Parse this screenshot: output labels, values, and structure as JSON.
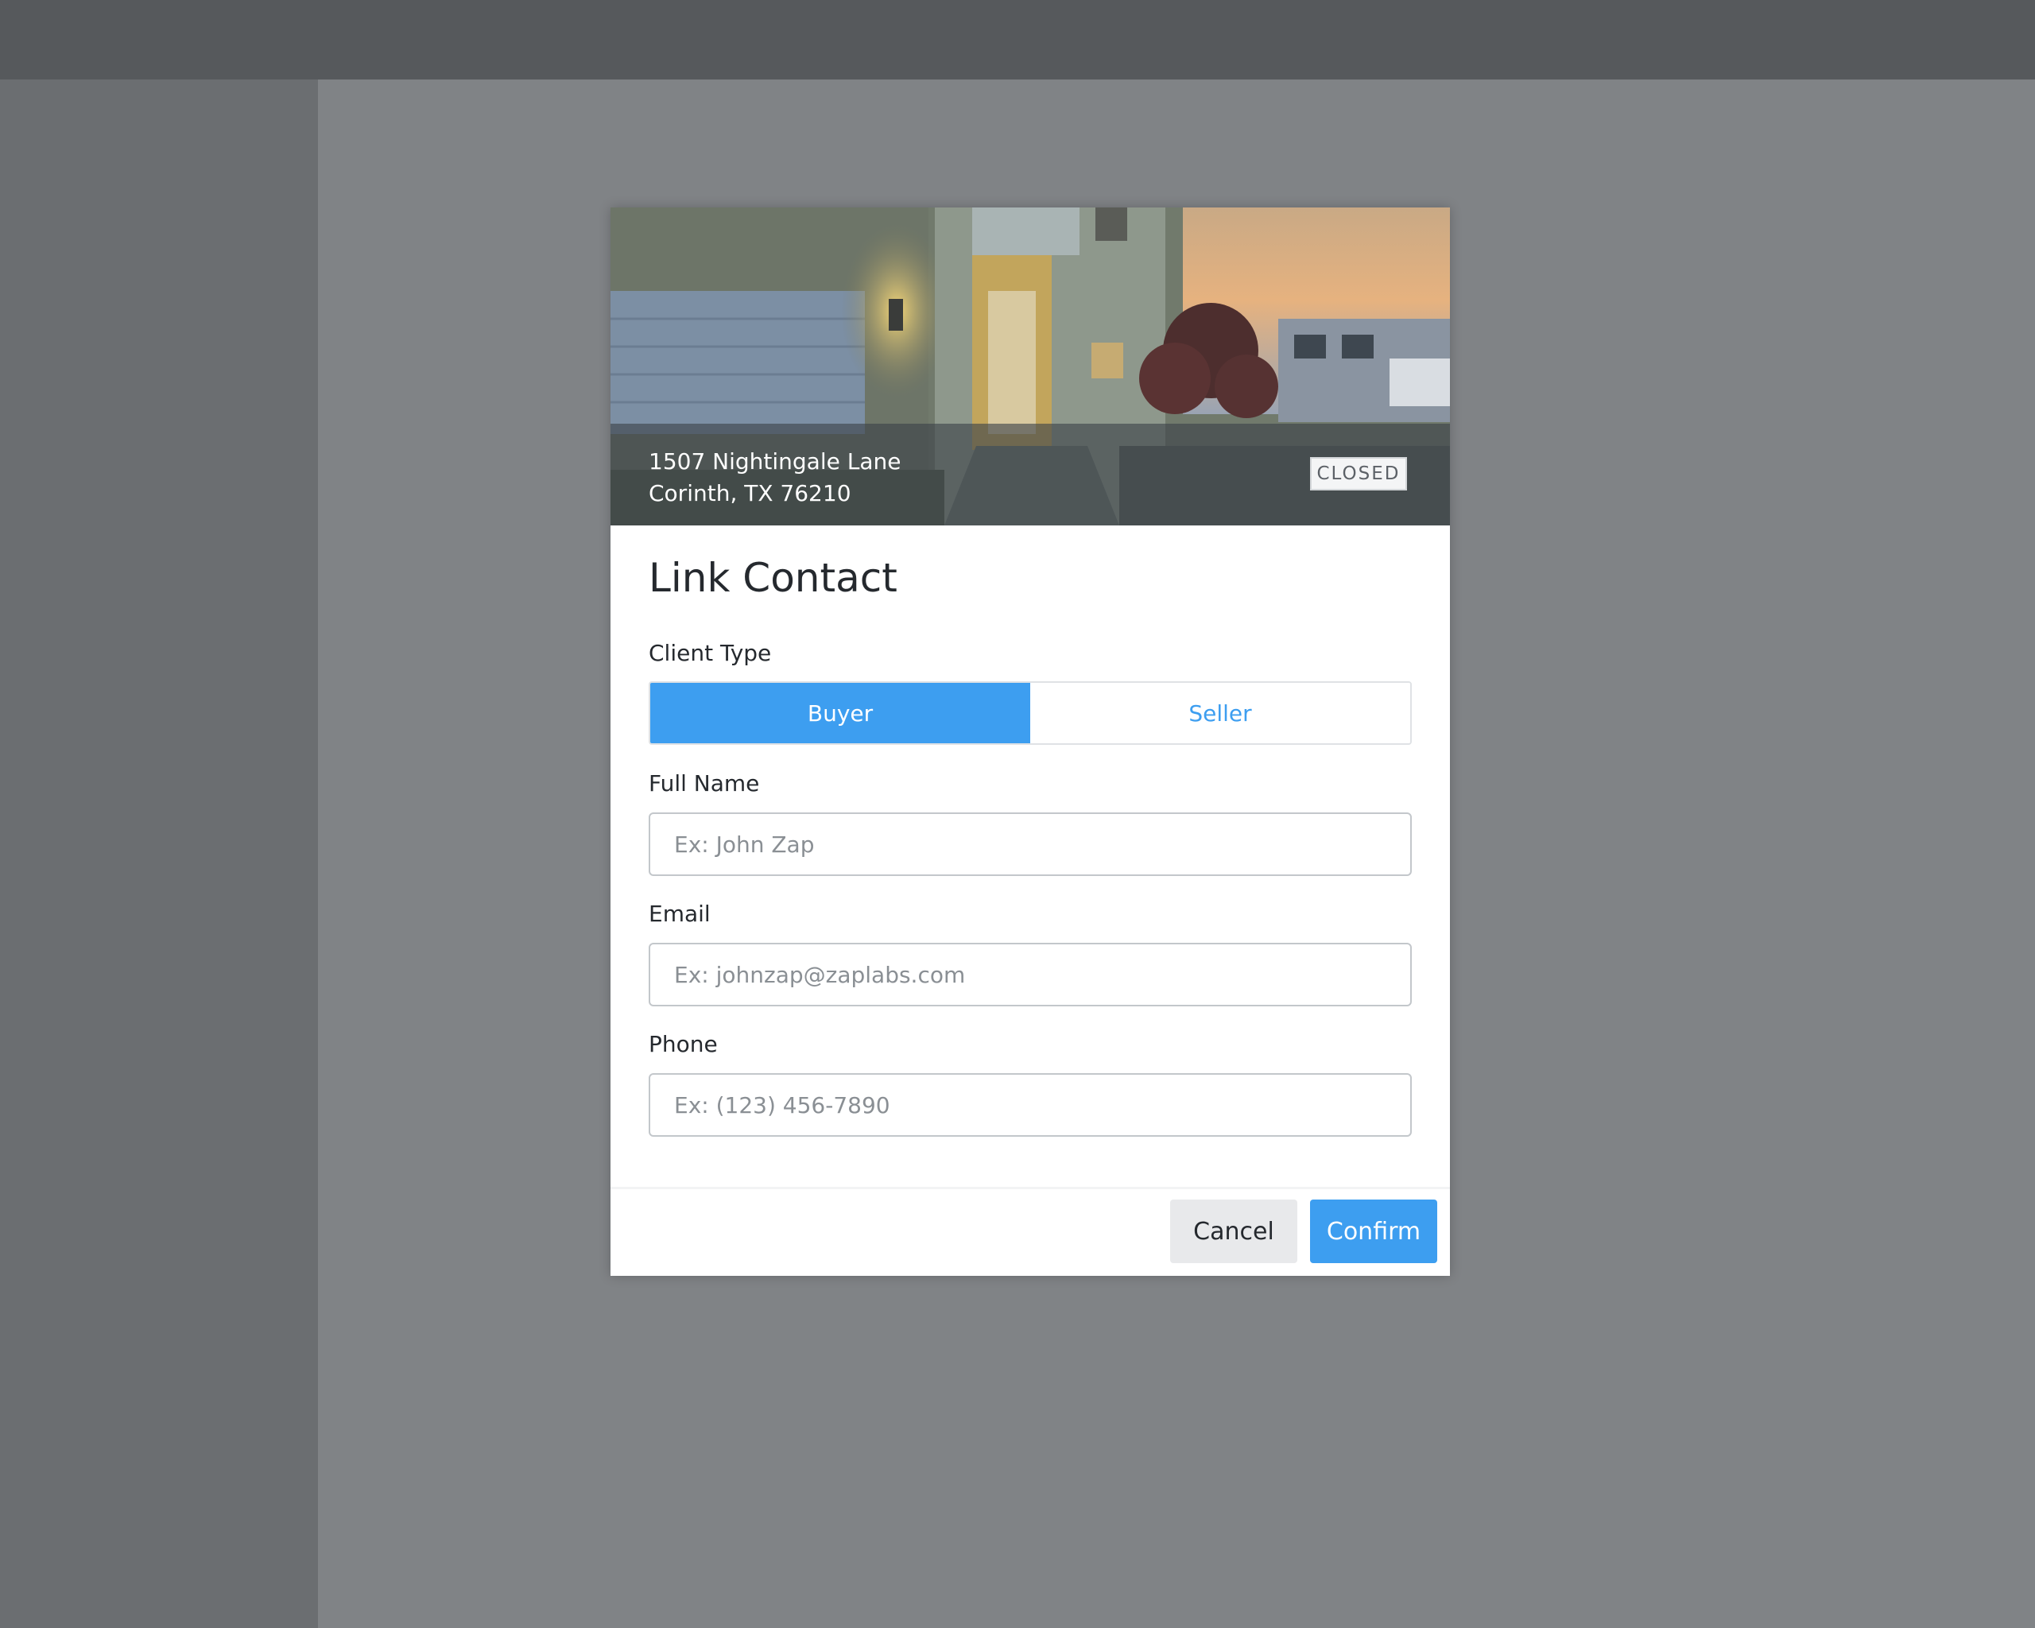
{
  "listing": {
    "address_line1": "1507 Nightingale Lane",
    "address_line2": "Corinth, TX 76210",
    "status": "CLOSED"
  },
  "modal": {
    "title": "Link Contact",
    "client_type": {
      "label": "Client Type",
      "options": [
        "Buyer",
        "Seller"
      ],
      "selected": "Buyer"
    },
    "full_name": {
      "label": "Full Name",
      "placeholder": "Ex: John Zap",
      "value": ""
    },
    "email": {
      "label": "Email",
      "placeholder": "Ex: johnzap@zaplabs.com",
      "value": ""
    },
    "phone": {
      "label": "Phone",
      "placeholder": "Ex: (123) 456-7890",
      "value": ""
    },
    "actions": {
      "cancel": "Cancel",
      "confirm": "Confirm"
    }
  },
  "colors": {
    "accent": "#3d9ef0",
    "backdrop": "#808386",
    "topbar": "#56595c",
    "sidebar": "#6b6e71"
  }
}
